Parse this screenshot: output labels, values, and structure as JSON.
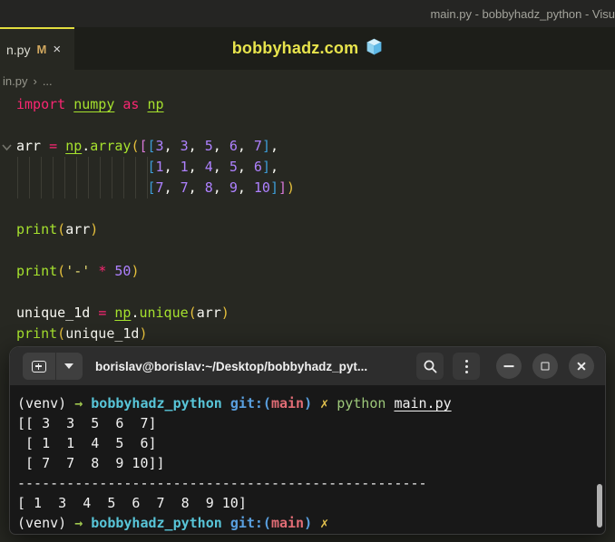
{
  "colors": {
    "pink": "#f92672",
    "green": "#a6e22e",
    "white": "#f8f8f2",
    "purple": "#ae81ff",
    "gold": "#e6c03c",
    "violet": "#d878d8",
    "blue": "#3d9cd6",
    "string": "#e6db74",
    "t_white": "#f1f1f1",
    "t_green": "#9ec54e",
    "t_cyan": "#58c5d8",
    "t_blue": "#5aa0e0",
    "t_red": "#e06c75",
    "t_yellow": "#e2c14e",
    "t_pygreen": "#9dc87a",
    "accent_yellow": "#e8e44c",
    "tab_active_border": "#e2dd3e",
    "modified_badge": "#d1a85f"
  },
  "title_bar": {
    "text": "main.py - bobbyhadz_python - Visu"
  },
  "tab_bar": {
    "tab_label": "n.py",
    "modified": "M",
    "close": "×",
    "watermark": "bobbyhadz.com"
  },
  "breadcrumb": {
    "file": "in.py",
    "sep": "›",
    "more": "..."
  },
  "editor": {
    "lines": [
      [
        [
          "import ",
          "pink"
        ],
        [
          "numpy",
          "green",
          "u"
        ],
        [
          " ",
          "white"
        ],
        [
          "as",
          "pink"
        ],
        [
          " ",
          "white"
        ],
        [
          "np",
          "green",
          "u"
        ]
      ],
      [],
      [
        [
          "arr ",
          "white"
        ],
        [
          "= ",
          "pink"
        ],
        [
          "np",
          "green",
          "u"
        ],
        [
          ".",
          "white"
        ],
        [
          "array",
          "green"
        ],
        [
          "(",
          "gold"
        ],
        [
          "[",
          "violet"
        ],
        [
          "[",
          "blue"
        ],
        [
          "3",
          "purple"
        ],
        [
          ", ",
          "white"
        ],
        [
          "3",
          "purple"
        ],
        [
          ", ",
          "white"
        ],
        [
          "5",
          "purple"
        ],
        [
          ", ",
          "white"
        ],
        [
          "6",
          "purple"
        ],
        [
          ", ",
          "white"
        ],
        [
          "7",
          "purple"
        ],
        [
          "]",
          "blue"
        ],
        [
          ",",
          "white"
        ]
      ],
      [
        [
          "                ",
          "white"
        ],
        [
          "[",
          "blue"
        ],
        [
          "1",
          "purple"
        ],
        [
          ", ",
          "white"
        ],
        [
          "1",
          "purple"
        ],
        [
          ", ",
          "white"
        ],
        [
          "4",
          "purple"
        ],
        [
          ", ",
          "white"
        ],
        [
          "5",
          "purple"
        ],
        [
          ", ",
          "white"
        ],
        [
          "6",
          "purple"
        ],
        [
          "]",
          "blue"
        ],
        [
          ",",
          "white"
        ]
      ],
      [
        [
          "                ",
          "white"
        ],
        [
          "[",
          "blue"
        ],
        [
          "7",
          "purple"
        ],
        [
          ", ",
          "white"
        ],
        [
          "7",
          "purple"
        ],
        [
          ", ",
          "white"
        ],
        [
          "8",
          "purple"
        ],
        [
          ", ",
          "white"
        ],
        [
          "9",
          "purple"
        ],
        [
          ", ",
          "white"
        ],
        [
          "10",
          "purple"
        ],
        [
          "]",
          "blue"
        ],
        [
          "]",
          "violet"
        ],
        [
          ")",
          "gold"
        ]
      ],
      [],
      [
        [
          "print",
          "green"
        ],
        [
          "(",
          "gold"
        ],
        [
          "arr",
          "white"
        ],
        [
          ")",
          "gold"
        ]
      ],
      [],
      [
        [
          "print",
          "green"
        ],
        [
          "(",
          "gold"
        ],
        [
          "'-'",
          "string"
        ],
        [
          " ",
          "white"
        ],
        [
          "*",
          "pink"
        ],
        [
          " ",
          "white"
        ],
        [
          "50",
          "purple"
        ],
        [
          ")",
          "gold"
        ]
      ],
      [],
      [
        [
          "unique_1d ",
          "white"
        ],
        [
          "= ",
          "pink"
        ],
        [
          "np",
          "green",
          "u"
        ],
        [
          ".",
          "white"
        ],
        [
          "unique",
          "green"
        ],
        [
          "(",
          "gold"
        ],
        [
          "arr",
          "white"
        ],
        [
          ")",
          "gold"
        ]
      ],
      [
        [
          "print",
          "green"
        ],
        [
          "(",
          "gold"
        ],
        [
          "unique_1d",
          "white"
        ],
        [
          ")",
          "gold"
        ]
      ]
    ]
  },
  "terminal": {
    "title": "borislav@borislav:~/Desktop/bobbyhadz_pyt...",
    "lines": [
      [
        [
          "(venv) ",
          "t_white"
        ],
        [
          "→ ",
          "t_green",
          "b"
        ],
        [
          "bobbyhadz_python ",
          "t_cyan",
          "b"
        ],
        [
          "git:(",
          "t_blue",
          "b"
        ],
        [
          "main",
          "t_red",
          "b"
        ],
        [
          ") ",
          "t_blue",
          "b"
        ],
        [
          "✗ ",
          "t_yellow",
          "b"
        ],
        [
          "python ",
          "t_pygreen"
        ],
        [
          "main.py",
          "t_white",
          "u"
        ]
      ],
      [
        [
          "[[ 3  3  5  6  7]",
          "t_white"
        ]
      ],
      [
        [
          " [ 1  1  4  5  6]",
          "t_white"
        ]
      ],
      [
        [
          " [ 7  7  8  9 10]]",
          "t_white"
        ]
      ],
      [
        [
          "--------------------------------------------------",
          "t_white"
        ]
      ],
      [
        [
          "[ 1  3  4  5  6  7  8  9 10]",
          "t_white"
        ]
      ],
      [
        [
          "(venv) ",
          "t_white"
        ],
        [
          "→ ",
          "t_green",
          "b"
        ],
        [
          "bobbyhadz_python ",
          "t_cyan",
          "b"
        ],
        [
          "git:(",
          "t_blue",
          "b"
        ],
        [
          "main",
          "t_red",
          "b"
        ],
        [
          ") ",
          "t_blue",
          "b"
        ],
        [
          "✗",
          "t_yellow",
          "b"
        ]
      ]
    ]
  }
}
